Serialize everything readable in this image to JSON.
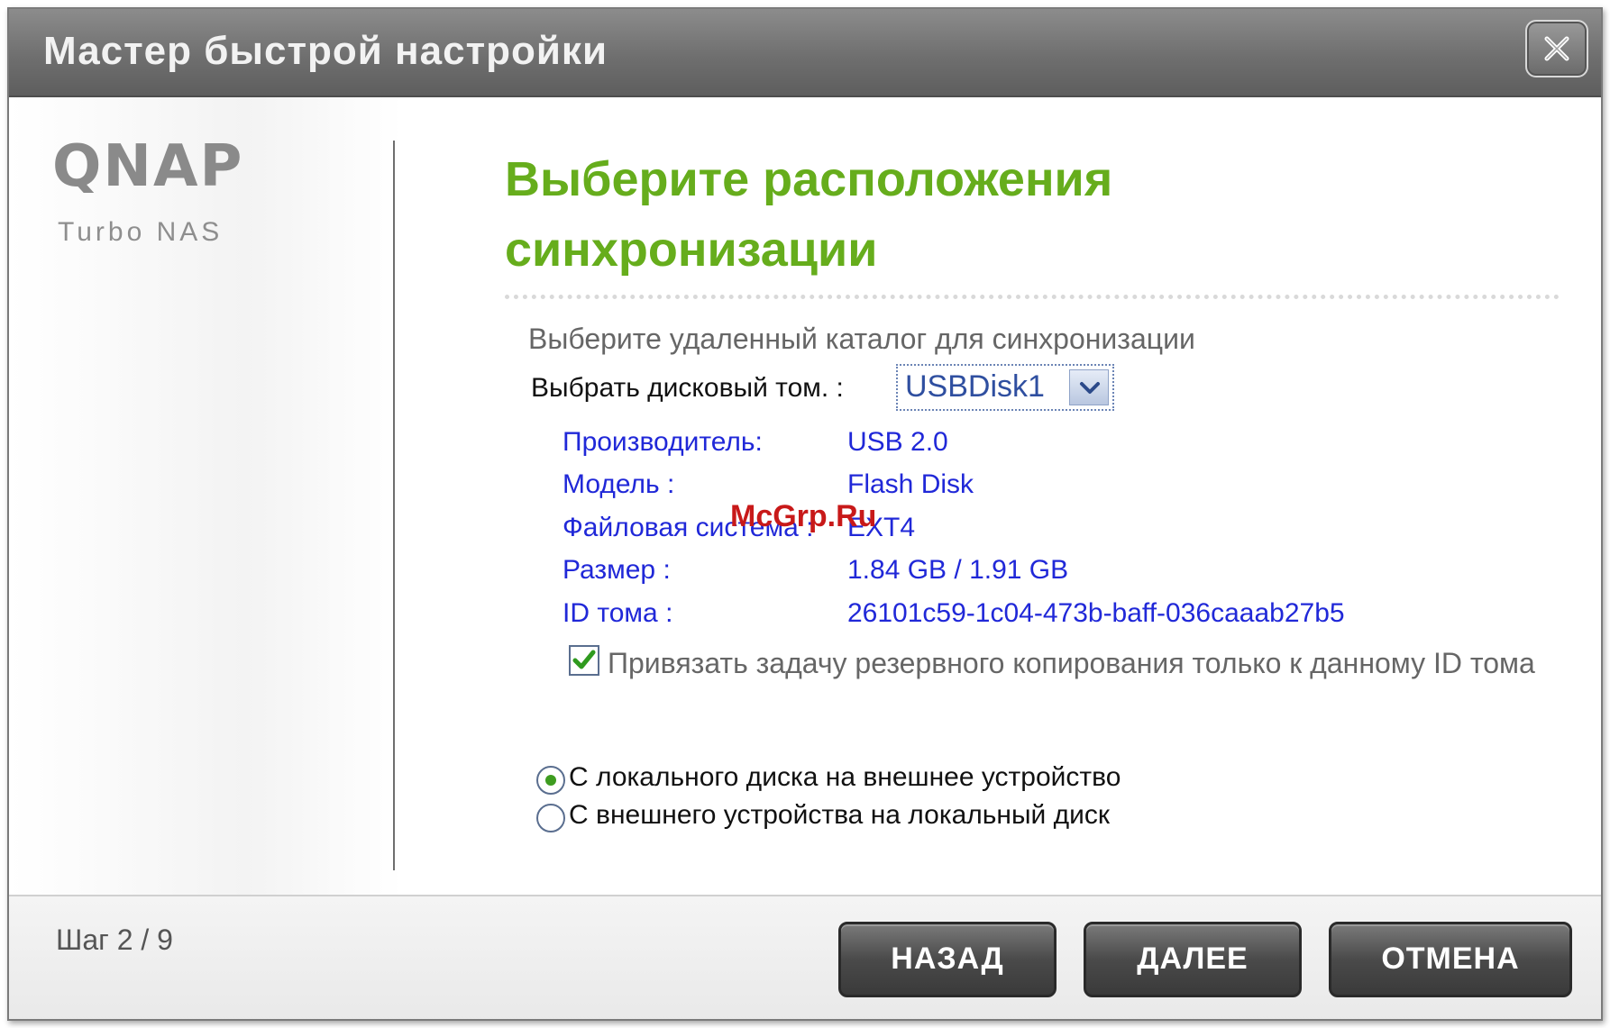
{
  "dialog": {
    "title": "Мастер быстрой настройки"
  },
  "sidebar": {
    "logo_text": "QNAP",
    "logo_subtitle": "Turbo NAS"
  },
  "main": {
    "heading_line1": "Выберите расположения",
    "heading_line2": "синхронизации",
    "intro": "Выберите удаленный каталог для синхронизации",
    "volume_label": "Выбрать дисковый том. :",
    "volume_selected": "USBDisk1",
    "info": [
      {
        "key": "Производитель:",
        "value": "USB 2.0"
      },
      {
        "key": "Модель :",
        "value": "Flash Disk"
      },
      {
        "key": "Файловая система :",
        "value": "EXT4"
      },
      {
        "key": "Размер :",
        "value": "1.84 GB / 1.91 GB"
      },
      {
        "key": "ID тома :",
        "value": "26101c59-1c04-473b-baff-036caaab27b5"
      }
    ],
    "bind_checkbox_label": "Привязать задачу резервного копирования только к данному ID тома",
    "bind_checkbox_checked": true,
    "direction_options": [
      {
        "label": "С локального диска на внешнее устройство",
        "selected": true
      },
      {
        "label": "С внешнего устройства на локальный диск",
        "selected": false
      }
    ],
    "watermark": "McGrp.Ru"
  },
  "footer": {
    "step": "Шаг 2 / 9",
    "back_label": "НАЗАД",
    "next_label": "ДАЛЕЕ",
    "cancel_label": "ОТМЕНА"
  },
  "colors": {
    "heading": "#66ad1c",
    "info_text": "#2028d8",
    "title_bar": "#6f6f6f",
    "button": "#4a4a4a"
  }
}
